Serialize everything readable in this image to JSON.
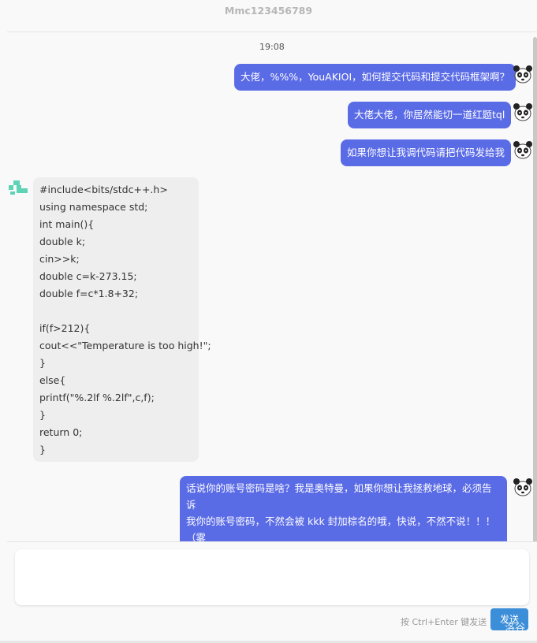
{
  "window": {
    "title": "Mmc123456789"
  },
  "chat": {
    "timestamp": "19:08",
    "messages": [
      {
        "side": "right",
        "text": "大佬，%%%，YouAKIOI，如何提交代码和提交代码框架啊？"
      },
      {
        "side": "right",
        "text": "大佬大佬，你居然能切一道红题tql"
      },
      {
        "side": "right",
        "text": "如果你想让我调代码请把代码发给我"
      },
      {
        "side": "left",
        "text": "#include<bits/stdc++.h>\nusing namespace std;\nint main(){\ndouble k;\ncin>>k;\ndouble c=k-273.15;\ndouble f=c*1.8+32;\n\nif(f>212){\ncout<<\"Temperature is too high!\";\n}\nelse{\nprintf(\"%.2lf %.2lf\",c,f);\n}\nreturn 0;\n}"
      },
      {
        "side": "right",
        "lines": [
          "话说你的账号密码是啥？我是奥特曼，如果你想让我拯救地球，必须告诉",
          "我你的账号密码，不然会被 kkk 封加棕名的哦，快说，不然不说！！！",
          "（雾"
        ]
      }
    ]
  },
  "composer": {
    "placeholder": "",
    "hint": "按 Ctrl+Enter 键发送",
    "send_label": "发送"
  },
  "watermark": "洛谷",
  "colors": {
    "accent": "#5a6be6",
    "send": "#3d8ed8",
    "bot_avatar": "#5fd3b5"
  }
}
